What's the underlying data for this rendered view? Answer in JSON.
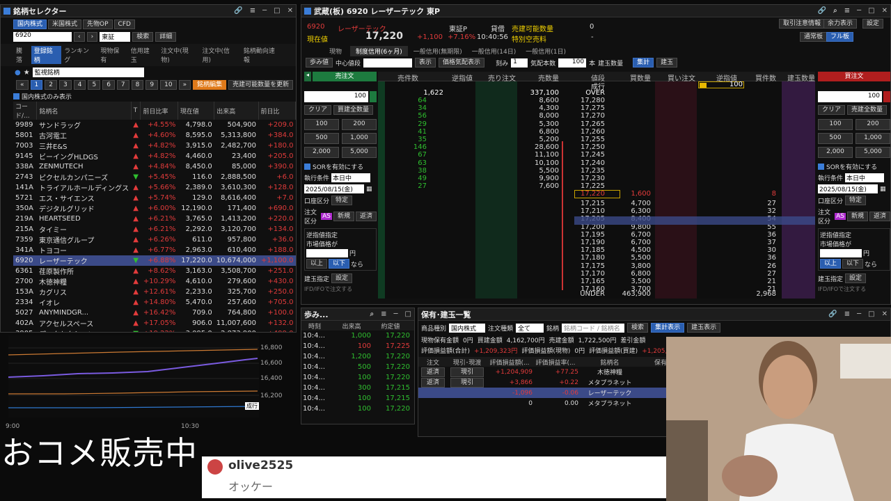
{
  "selector": {
    "title": "銘柄セレクター",
    "tabs": [
      "国内株式",
      "米国株式",
      "先物OP",
      "CFD"
    ],
    "code": "6920",
    "market": "東証",
    "btn_search": "検索",
    "btn_detail": "詳細",
    "subtabs": [
      "騰落",
      "登録銘柄",
      "ランキング",
      "現物保有",
      "信用建玉",
      "注文中(現物)",
      "注文中(信用)",
      "銘柄動向速報"
    ],
    "list_name": "監視銘柄",
    "pages": [
      "1",
      "2",
      "3",
      "4",
      "5",
      "6",
      "7",
      "8",
      "9",
      "10"
    ],
    "btn_edit": "銘柄編集",
    "btn_update": "売建可能数量を更新",
    "chk": "国内株式のみ表示",
    "headers": [
      "コード/...",
      "銘柄名",
      "T",
      "前日比率",
      "現在値",
      "出来高",
      "前日比"
    ],
    "rows": [
      [
        "9989",
        "サンドラッグ",
        "▲",
        "+4.55%",
        "4,798.0",
        "504,900",
        "+209.0"
      ],
      [
        "5801",
        "古河電工",
        "▲",
        "+4.60%",
        "8,595.0",
        "5,313,800",
        "+384.0"
      ],
      [
        "7003",
        "三井E&S",
        "▲",
        "+4.82%",
        "3,915.0",
        "2,482,700",
        "+180.0"
      ],
      [
        "9145",
        "ビーイングHLDGS",
        "▲",
        "+4.82%",
        "4,460.0",
        "23,400",
        "+205.0"
      ],
      [
        "338A",
        "ZENMUTECH",
        "▲",
        "+4.84%",
        "8,450.0",
        "85,000",
        "+390.0"
      ],
      [
        "2743",
        "ピクセルカンパニーズ",
        "▼",
        "+5.45%",
        "116.0",
        "2,888,500",
        "+6.0"
      ],
      [
        "141A",
        "トライアルホールディングス",
        "▲",
        "+5.66%",
        "2,389.0",
        "3,610,300",
        "+128.0"
      ],
      [
        "5721",
        "エス・サイエンス",
        "▲",
        "+5.74%",
        "129.0",
        "8,616,400",
        "+7.0"
      ],
      [
        "350A",
        "デジタルグリッド",
        "▲",
        "+6.00%",
        "12,190.0",
        "171,400",
        "+690.0"
      ],
      [
        "219A",
        "HEARTSEED",
        "▲",
        "+6.21%",
        "3,765.0",
        "1,413,200",
        "+220.0"
      ],
      [
        "215A",
        "タイミー",
        "▲",
        "+6.21%",
        "2,292.0",
        "3,120,700",
        "+134.0"
      ],
      [
        "7359",
        "東京通信グループ",
        "▲",
        "+6.26%",
        "611.0",
        "957,800",
        "+36.0"
      ],
      [
        "341A",
        "トヨコー",
        "▲",
        "+6.77%",
        "2,963.0",
        "610,400",
        "+188.0"
      ],
      [
        "6920",
        "レーザーテック",
        "▼",
        "+6.88%",
        "17,220.0",
        "10,674,000",
        "+1,100.0"
      ],
      [
        "6361",
        "荏原製作所",
        "▲",
        "+8.62%",
        "3,163.0",
        "3,508,700",
        "+251.0"
      ],
      [
        "2700",
        "木徳神糧",
        "▲",
        "+10.29%",
        "4,610.0",
        "279,600",
        "+430.0"
      ],
      [
        "153A",
        "カグリス",
        "▲",
        "+12.61%",
        "2,233.0",
        "325,700",
        "+250.0"
      ],
      [
        "2334",
        "イオレ",
        "▲",
        "+14.80%",
        "5,470.0",
        "257,600",
        "+705.0"
      ],
      [
        "5027",
        "ANYMINDGR...",
        "▲",
        "+16.42%",
        "709.0",
        "764,800",
        "+100.0"
      ],
      [
        "402A",
        "アクセルスペース",
        "▲",
        "+17.05%",
        "906.0",
        "11,007,600",
        "+132.0"
      ],
      [
        "3905",
        "データセクション",
        "▼",
        "+19.22%",
        "3,095.0",
        "2,873,900",
        "+499.0"
      ]
    ]
  },
  "chart": {
    "yticks": [
      "16,800",
      "16,600",
      "16,400",
      "16,200"
    ],
    "xticks": [
      "9:00",
      "10:30"
    ],
    "badge": "成行"
  },
  "board": {
    "title": "武蔵(板) 6920 レーザーテック 東P",
    "code": "6920",
    "name": "レーザーテック",
    "market": "東証P",
    "label_now": "現在値",
    "price": "17,220",
    "change": "+1,100",
    "pct": "+7.16%",
    "time": "10:40:56",
    "credit": "貸借",
    "sell_avail": "売建可能数量",
    "special": "特別空売料",
    "qty0": "0",
    "dash": "-",
    "hbtns": [
      "取引注意情報",
      "余力表示"
    ],
    "hbtns2": [
      "通常板",
      "フル板"
    ],
    "settings": "設定",
    "tabs": [
      "現物",
      "制度信用(6ヶ月)",
      "一般信用(無期限)",
      "一般信用(14日)",
      "一般信用(1日)"
    ],
    "bar": {
      "ayumi": "歩み値",
      "center": "中心値段",
      "display": "表示",
      "show_orders": "価格気配表示",
      "tick": "刻み",
      "tick_val": "1",
      "count_label": "気配本数",
      "count": "100",
      "unit": "本",
      "tate": "建玉数量",
      "total": "集計",
      "tate2": "建玉"
    },
    "cols": [
      "売件数",
      "逆指値",
      "売り注文",
      "売数量",
      "値段",
      "買数量",
      "買い注文",
      "逆指値",
      "買件数",
      "建玉数量"
    ],
    "over_row": [
      "1,622",
      "337,100",
      "OVER"
    ],
    "nariyuki": "成行",
    "nariyuki_buy": "100",
    "asks": [
      [
        "64",
        "8,600",
        "17,280"
      ],
      [
        "34",
        "4,300",
        "17,275"
      ],
      [
        "56",
        "8,000",
        "17,270"
      ],
      [
        "29",
        "5,300",
        "17,265"
      ],
      [
        "41",
        "6,800",
        "17,260"
      ],
      [
        "35",
        "5,200",
        "17,255"
      ],
      [
        "146",
        "28,600",
        "17,250"
      ],
      [
        "67",
        "11,100",
        "17,245"
      ],
      [
        "63",
        "10,100",
        "17,240"
      ],
      [
        "38",
        "5,500",
        "17,235"
      ],
      [
        "49",
        "9,900",
        "17,230"
      ],
      [
        "27",
        "7,600",
        "17,225"
      ]
    ],
    "mid": [
      "17,220",
      "1,600",
      "8"
    ],
    "bids": [
      [
        "17,215",
        "4,700",
        "27"
      ],
      [
        "17,210",
        "6,300",
        "32"
      ],
      [
        "17,205",
        "8,400",
        "54"
      ],
      [
        "17,200",
        "9,800",
        "55"
      ],
      [
        "17,195",
        "6,700",
        "36"
      ],
      [
        "17,190",
        "6,700",
        "37"
      ],
      [
        "17,185",
        "4,500",
        "30"
      ],
      [
        "17,180",
        "5,500",
        "36"
      ],
      [
        "17,175",
        "3,800",
        "26"
      ],
      [
        "17,170",
        "6,800",
        "27"
      ],
      [
        "17,165",
        "3,500",
        "21"
      ],
      [
        "17,160",
        "3,700",
        "21"
      ]
    ],
    "under": [
      "UNDER",
      "463,900",
      "2,968"
    ],
    "order": {
      "sell": "売注文",
      "buy": "買注文",
      "qty": "100",
      "clear": "クリア",
      "sell_all": "買建全数量",
      "buy_all": "売建全数量",
      "q": [
        "100",
        "200",
        "500",
        "1,000",
        "2,000",
        "5,000"
      ],
      "sor": "SORを有効にする",
      "exec": "執行条件",
      "exec_val": "本日中",
      "date": "2025/08/15(金)",
      "acct": "口座区分",
      "acct_val": "特定",
      "ord": "注文区分",
      "as": "AS",
      "new": "新規",
      "close": "返済",
      "stop": "逆指値指定",
      "mkt": "市場価格が",
      "yen": "円",
      "above": "以上",
      "below": "以下",
      "nara": "なら",
      "tate": "建玉指定",
      "set": "設定",
      "ifd": "IFD/IFOで注文する"
    }
  },
  "ayumi": {
    "title": "歩み...",
    "headers": [
      "時刻",
      "出来高",
      "約定値"
    ],
    "rows": [
      [
        "10:4...",
        "1,000",
        "17,220"
      ],
      [
        "10:4...",
        "100",
        "17,225"
      ],
      [
        "10:4...",
        "1,200",
        "17,220"
      ],
      [
        "10:4...",
        "500",
        "17,220"
      ],
      [
        "10:4...",
        "100",
        "17,220"
      ],
      [
        "10:4...",
        "300",
        "17,215"
      ],
      [
        "10:4...",
        "100",
        "17,215"
      ],
      [
        "10:4...",
        "100",
        "17,220"
      ]
    ]
  },
  "pos": {
    "title": "保有･建玉一覧",
    "f1": "商品種別",
    "f1v": "国内株式",
    "f2": "注文種類",
    "f2v": "全て",
    "f3": "銘柄",
    "f3p": "銘柄コード / 銘柄名",
    "search": "検索",
    "sum": "集計表示",
    "tate": "建玉表示",
    "l1": "現物保有金額",
    "v1": "0円",
    "l2": "買建金額",
    "v2": "4,162,700円",
    "l3": "売建金額",
    "v3": "1,722,500円",
    "l4": "差引金額",
    "l5": "評価損益額(合計)",
    "v5": "+1,209,323円",
    "l6": "評価損益額(現物)",
    "v6": "0円",
    "l7": "評価損益額(買建)",
    "v7": "+1,205,999円",
    "headers": [
      "注文",
      "現引･現渡",
      "評価損益額(...",
      "評価損益率(...",
      "銘柄名",
      "保有/"
    ],
    "rows": [
      [
        "返済",
        "現引",
        "+1,204,909",
        "+77.25",
        "木徳神糧"
      ],
      [
        "返済",
        "現引",
        "+3,866",
        "+0.22",
        "メタプラネット"
      ],
      [
        "",
        "",
        "-1,096",
        "-0.06",
        "レーザーテック"
      ],
      [
        "",
        "",
        "0",
        "0.00",
        "メタプラネット"
      ]
    ]
  },
  "overlay": {
    "big": "おコメ販売中",
    "user": "olive2525",
    "comment": "オッケー"
  }
}
